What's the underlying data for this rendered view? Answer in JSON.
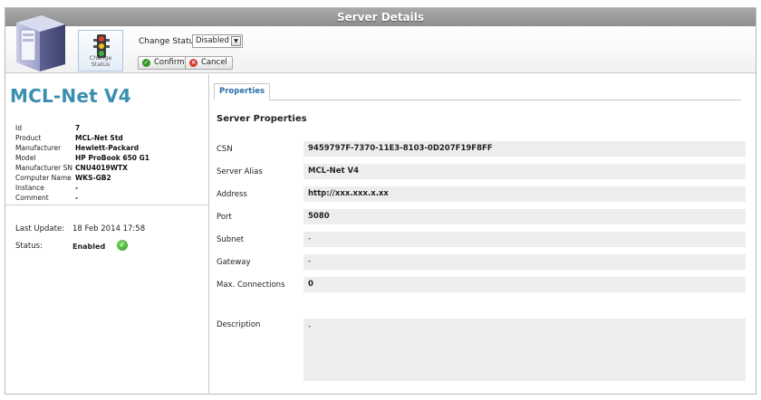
{
  "window": {
    "title": "Server Details"
  },
  "toolbar": {
    "change_status_tile_label_line1": "Change",
    "change_status_tile_label_line2": "Status",
    "change_status_label": "Change Status",
    "status_selected": "Disabled",
    "confirm_label": "Confirm",
    "cancel_label": "Cancel"
  },
  "summary": {
    "title": "MCL-Net V4",
    "info": [
      {
        "key": "Id",
        "value": "7"
      },
      {
        "key": "Product",
        "value": "MCL-Net Std"
      },
      {
        "key": "Manufacturer",
        "value": "Hewlett-Packard"
      },
      {
        "key": "Model",
        "value": "HP ProBook 650 G1"
      },
      {
        "key": "Manufacturer SN",
        "value": "CNU4019WTX"
      },
      {
        "key": "Computer Name",
        "value": "WKS-GB2"
      },
      {
        "key": "Instance",
        "value": "-"
      },
      {
        "key": "Comment",
        "value": "-"
      }
    ],
    "last_update_label": "Last Update:",
    "last_update_value": "18 Feb 2014 17:58",
    "status_label": "Status:",
    "status_value": "Enabled"
  },
  "details": {
    "tab_label": "Properties",
    "section_title": "Server Properties",
    "properties": [
      {
        "label": "CSN",
        "value": "9459797F-7370-11E3-8103-0D207F19F8FF"
      },
      {
        "label": "Server Alias",
        "value": "MCL-Net V4"
      },
      {
        "label": "Address",
        "value": "http://xxx.xxx.x.xx"
      },
      {
        "label": "Port",
        "value": "5080"
      },
      {
        "label": "Subnet",
        "value": "-"
      },
      {
        "label": "Gateway",
        "value": "-"
      },
      {
        "label": "Max. Connections",
        "value": "0"
      },
      {
        "label": "Description",
        "value": "-"
      }
    ]
  },
  "colors": {
    "title_accent": "#3a8fae",
    "tab_text": "#2a6fa8",
    "ok_green": "#2f9a1f",
    "cancel_red": "#d13a2a"
  }
}
